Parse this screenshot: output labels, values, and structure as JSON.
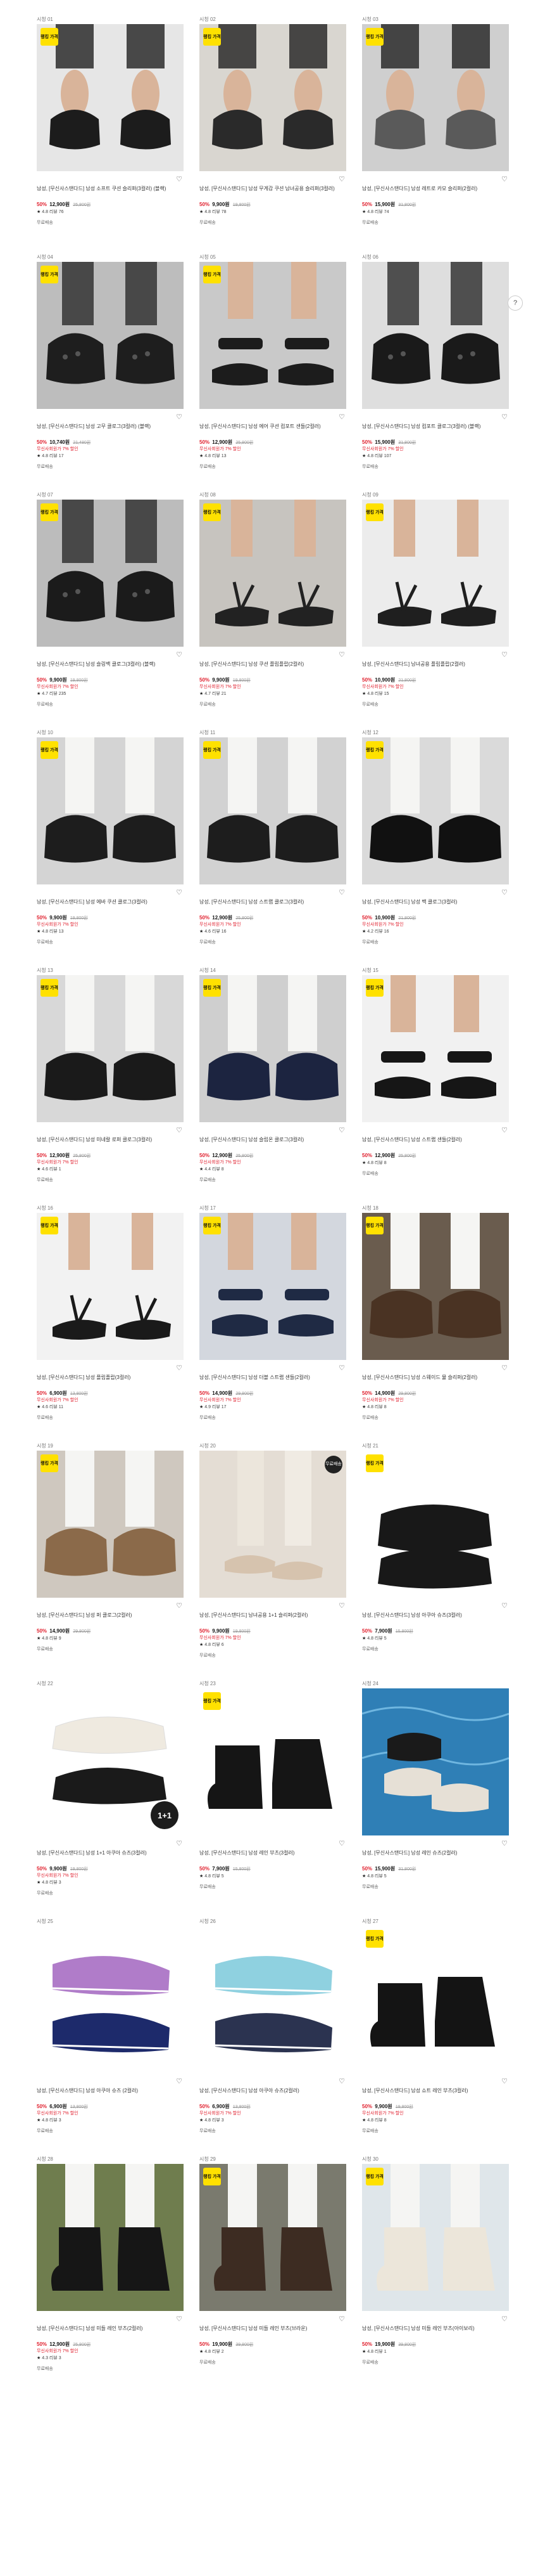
{
  "ui": {
    "badge_text": "랭킹 가격",
    "heart": "♡",
    "star": "★",
    "scroll_up": "?",
    "label_plus": "1+1",
    "label_free": "무료배송"
  },
  "products": [
    {
      "num": "시청 01",
      "badge": true,
      "title": "남성, [무신사스탠다드] 남성 소프트 쿠션 슬리퍼(3컬러) (블랙)",
      "pct": "50%",
      "price": "12,900원",
      "orig": "25,800원",
      "promo": "",
      "rating": "4.8",
      "reviews": "리뷰 76",
      "tag": "무료배송",
      "art": "slide",
      "bg": "#e6e6e6",
      "sc": "#1c1c1c"
    },
    {
      "num": "시청 02",
      "badge": true,
      "title": "남성, [무신사스탠다드] 남성 무게감 쿠션 남녀공용 슬리퍼(3컬러)",
      "pct": "50%",
      "price": "9,900원",
      "orig": "19,800원",
      "promo": "",
      "rating": "4.8",
      "reviews": "리뷰 78",
      "tag": "무료배송",
      "art": "slide",
      "bg": "#d9d6d0",
      "sc": "#2a2a2a"
    },
    {
      "num": "시청 03",
      "badge": true,
      "title": "남성, [무신사스탠다드] 남성 레트로 카모 슬리퍼(2컬러)",
      "pct": "50%",
      "price": "15,900원",
      "orig": "31,800원",
      "promo": "",
      "rating": "4.8",
      "reviews": "리뷰 74",
      "tag": "무료배송",
      "art": "slide",
      "bg": "#cfcfcf",
      "sc": "#5a5a5a"
    },
    {
      "num": "시청 04",
      "badge": true,
      "title": "남성, [무신사스탠다드] 남성 고무 클로그(3컬러) (블랙)",
      "pct": "50%",
      "price": "10,740원",
      "orig": "21,480원",
      "promo": "무신사회원가 7% 할인",
      "rating": "4.8",
      "reviews": "리뷰 17",
      "tag": "무료배송",
      "art": "clog",
      "bg": "#bdbdbd",
      "sc": "#1e1e1e"
    },
    {
      "num": "시청 05",
      "badge": true,
      "title": "남성, [무신사스탠다드] 남성 에어 쿠션 컴포트 샌들(2컬러)",
      "pct": "50%",
      "price": "12,900원",
      "orig": "25,800원",
      "promo": "무신사회원가 7% 할인",
      "rating": "4.8",
      "reviews": "리뷰 13",
      "tag": "무료배송",
      "art": "sandal",
      "bg": "#c9c9c9",
      "sc": "#1c1c1c"
    },
    {
      "num": "시청 06",
      "badge": false,
      "title": "남성, [무신사스탠다드] 남성 컴포트 클로그(3컬러) (블랙)",
      "pct": "50%",
      "price": "15,900원",
      "orig": "31,800원",
      "promo": "무신사회원가 7% 할인",
      "rating": "4.8",
      "reviews": "리뷰 107",
      "tag": "무료배송",
      "art": "clog",
      "bg": "#dedede",
      "sc": "#1a1a1a"
    },
    {
      "num": "시청 07",
      "badge": true,
      "title": "남성, [무신사스탠다드] 남성 슬링백 클로그(3컬러) (블랙)",
      "pct": "50%",
      "price": "9,900원",
      "orig": "19,800원",
      "promo": "무신사회원가 7% 할인",
      "rating": "4.7",
      "reviews": "리뷰 235",
      "tag": "무료배송",
      "art": "clog",
      "bg": "#bcbcbc",
      "sc": "#1b1b1b"
    },
    {
      "num": "시청 08",
      "badge": true,
      "title": "남성, [무신사스탠다드] 남성 쿠션 플립플랍(2컬러)",
      "pct": "50%",
      "price": "9,900원",
      "orig": "19,800원",
      "promo": "무신사회원가 7% 할인",
      "rating": "4.7",
      "reviews": "리뷰 21",
      "tag": "무료배송",
      "art": "flip",
      "bg": "#c7c4bf",
      "sc": "#222222"
    },
    {
      "num": "시청 09",
      "badge": true,
      "title": "남성, [무신사스탠다드] 남녀공용 플립플랍(2컬러)",
      "pct": "50%",
      "price": "10,900원",
      "orig": "21,800원",
      "promo": "무신사회원가 7% 할인",
      "rating": "4.8",
      "reviews": "리뷰 15",
      "tag": "무료배송",
      "art": "flip",
      "bg": "#ececec",
      "sc": "#1f1f1f"
    },
    {
      "num": "시청 10",
      "badge": true,
      "title": "남성, [무신사스탠다드] 남성 에바 쿠션 클로그(3컬러)",
      "pct": "50%",
      "price": "9,900원",
      "orig": "19,800원",
      "promo": "무신사회원가 7% 할인",
      "rating": "4.8",
      "reviews": "리뷰 13",
      "tag": "무료배송",
      "art": "clogsock",
      "bg": "#d4d4d4",
      "sc": "#1d1d1d"
    },
    {
      "num": "시청 11",
      "badge": true,
      "title": "남성, [무신사스탠다드] 남성 스트랩 클로그(3컬러)",
      "pct": "50%",
      "price": "12,900원",
      "orig": "25,800원",
      "promo": "무신사회원가 7% 할인",
      "rating": "4.6",
      "reviews": "리뷰 16",
      "tag": "무료배송",
      "art": "clogsock",
      "bg": "#d2d2d2",
      "sc": "#1d1d1d"
    },
    {
      "num": "시청 12",
      "badge": true,
      "title": "남성, [무신사스탠다드] 남성 백 클로그(3컬러)",
      "pct": "50%",
      "price": "10,900원",
      "orig": "21,800원",
      "promo": "무신사회원가 7% 할인",
      "rating": "4.2",
      "reviews": "리뷰 16",
      "tag": "무료배송",
      "art": "clogsock",
      "bg": "#dadada",
      "sc": "#111111"
    },
    {
      "num": "시청 13",
      "badge": true,
      "title": "남성, [무신사스탠다드] 남성 미네랄 로퍼 클로그(3컬러)",
      "pct": "50%",
      "price": "12,900원",
      "orig": "25,800원",
      "promo": "무신사회원가 7% 할인",
      "rating": "4.6",
      "reviews": "리뷰 1",
      "tag": "무료배송",
      "art": "clogsock",
      "bg": "#d8d8d8",
      "sc": "#1a1a1a"
    },
    {
      "num": "시청 14",
      "badge": true,
      "title": "남성, [무신사스탠다드] 남성 슬립온 클로그(3컬러)",
      "pct": "50%",
      "price": "12,900원",
      "orig": "25,800원",
      "promo": "무신사회원가 7% 할인",
      "rating": "4.4",
      "reviews": "리뷰 8",
      "tag": "무료배송",
      "art": "clogsock",
      "bg": "#cfcfcf",
      "sc": "#1c2440"
    },
    {
      "num": "시청 15",
      "badge": true,
      "title": "남성, [무신사스탠다드] 남성 스트랩 샌들(2컬러)",
      "pct": "50%",
      "price": "12,900원",
      "orig": "25,800원",
      "promo": "",
      "rating": "4.8",
      "reviews": "리뷰 8",
      "tag": "무료배송",
      "art": "sandal",
      "bg": "#f1f1f1",
      "sc": "#161616"
    },
    {
      "num": "시청 16",
      "badge": true,
      "title": "남성, [무신사스탠다드] 남성 플립플랍(3컬러)",
      "pct": "50%",
      "price": "6,900원",
      "orig": "13,800원",
      "promo": "무신사회원가 7% 할인",
      "rating": "4.6",
      "reviews": "리뷰 11",
      "tag": "무료배송",
      "art": "flip",
      "bg": "#f2f2f2",
      "sc": "#1a1a1a"
    },
    {
      "num": "시청 17",
      "badge": true,
      "title": "남성, [무신사스탠다드] 남성 더블 스트랩 샌들(2컬러)",
      "pct": "50%",
      "price": "14,900원",
      "orig": "29,800원",
      "promo": "무신사회원가 7% 할인",
      "rating": "4.9",
      "reviews": "리뷰 17",
      "tag": "무료배송",
      "art": "sandal",
      "bg": "#d3d7de",
      "sc": "#1f2a44"
    },
    {
      "num": "시청 18",
      "badge": true,
      "title": "남성, [무신사스탠다드] 남성 스웨이드 뮬 슬리퍼(2컬러)",
      "pct": "50%",
      "price": "14,900원",
      "orig": "29,800원",
      "promo": "무신사회원가 7% 할인",
      "rating": "4.8",
      "reviews": "리뷰 8",
      "tag": "무료배송",
      "art": "clogsock",
      "bg": "#6a5c4e",
      "sc": "#4a3323"
    },
    {
      "num": "시청 19",
      "badge": true,
      "title": "남성, [무신사스탠다드] 남성 퍼 클로그(2컬러)",
      "pct": "50%",
      "price": "14,900원",
      "orig": "29,800원",
      "promo": "",
      "rating": "4.8",
      "reviews": "리뷰 9",
      "tag": "무료배송",
      "art": "clogsock",
      "bg": "#cfc8bf",
      "sc": "#8b6a4a"
    },
    {
      "num": "시청 20",
      "badge": false,
      "title": "남성, [무신사스탠다드] 남녀공용 1+1 슬리퍼(2컬러)",
      "pct": "50%",
      "price": "9,900원",
      "orig": "19,800원",
      "promo": "무신사회원가 7% 할인",
      "rating": "4.8",
      "reviews": "리뷰 6",
      "tag": "무료배송",
      "art": "legs",
      "bg": "#e4ddd4",
      "sc": "#d6c3ae",
      "free": true
    },
    {
      "num": "시청 21",
      "badge": true,
      "title": "남성, [무신사스탠다드] 남성 아쿠아 슈즈(3컬러)",
      "pct": "50%",
      "price": "7,900원",
      "orig": "15,800원",
      "promo": "",
      "rating": "4.8",
      "reviews": "리뷰 5",
      "tag": "무료배송",
      "art": "bowl",
      "bg": "#ffffff",
      "sc": "#181818"
    },
    {
      "num": "시청 22",
      "badge": false,
      "title": "남성, [무신사스탠다드] 남성 1+1 아쿠아 슈즈(3컬러)",
      "pct": "50%",
      "price": "9,900원",
      "orig": "19,800원",
      "promo": "무신사회원가 7% 할인",
      "rating": "4.8",
      "reviews": "리뷰 3",
      "tag": "무료배송",
      "art": "pair",
      "bg": "#ffffff",
      "sc": "#efeae0",
      "plus": true
    },
    {
      "num": "시청 23",
      "badge": true,
      "title": "남성, [무신사스탠다드] 남성 레인 부츠(3컬러)",
      "pct": "50%",
      "price": "7,900원",
      "orig": "15,800원",
      "promo": "",
      "rating": "4.8",
      "reviews": "리뷰 5",
      "tag": "무료배송",
      "art": "boot",
      "bg": "#ffffff",
      "sc": "#151515"
    },
    {
      "num": "시청 24",
      "badge": false,
      "title": "남성, [무신사스탠다드] 남성 레인 슈즈(2컬러)",
      "pct": "50%",
      "price": "15,900원",
      "orig": "31,800원",
      "promo": "",
      "rating": "4.8",
      "reviews": "리뷰 5",
      "tag": "무료배송",
      "art": "pool",
      "bg": "#3f8fc4",
      "sc": "#e6e0d6"
    },
    {
      "num": "시청 25",
      "badge": false,
      "title": "남성, [무신사스탠다드] 남성 아쿠아 슈즈 (2컬러)",
      "pct": "50%",
      "price": "6,900원",
      "orig": "13,800원",
      "promo": "무신사회원가 7% 할인",
      "rating": "4.8",
      "reviews": "리뷰 3",
      "tag": "무료배송",
      "art": "aqua",
      "bg": "#ffffff",
      "sc": "#b07cc9",
      "sc2": "#1d2a6b"
    },
    {
      "num": "시청 26",
      "badge": false,
      "title": "남성, [무신사스탠다드] 남성 아쿠아 슈즈(2컬러)",
      "pct": "50%",
      "price": "6,900원",
      "orig": "13,800원",
      "promo": "무신사회원가 7% 할인",
      "rating": "4.8",
      "reviews": "리뷰 3",
      "tag": "무료배송",
      "art": "aqua",
      "bg": "#ffffff",
      "sc": "#8fd1e0",
      "sc2": "#2b3350"
    },
    {
      "num": "시청 27",
      "badge": true,
      "title": "남성, [무신사스탠다드] 남성 쇼트 레인 부츠(3컬러)",
      "pct": "50%",
      "price": "9,900원",
      "orig": "19,800원",
      "promo": "무신사회원가 7% 할인",
      "rating": "4.8",
      "reviews": "리뷰 8",
      "tag": "무료배송",
      "art": "boot",
      "bg": "#ffffff",
      "sc": "#141414"
    },
    {
      "num": "시청 28",
      "badge": false,
      "title": "남성, [무신사스탠다드] 남성 미들 레인 부츠(2컬러)",
      "pct": "50%",
      "price": "12,900원",
      "orig": "25,800원",
      "promo": "무신사회원가 7% 할인",
      "rating": "4.3",
      "reviews": "리뷰 3",
      "tag": "무료배송",
      "art": "bootsock",
      "bg": "#6f7d4e",
      "sc": "#161616"
    },
    {
      "num": "시청 29",
      "badge": true,
      "title": "남성, [무신사스탠다드] 남성 미들 레인 부츠(브라운)",
      "pct": "50%",
      "price": "19,900원",
      "orig": "39,800원",
      "promo": "",
      "rating": "4.8",
      "reviews": "리뷰 2",
      "tag": "무료배송",
      "art": "bootsock",
      "bg": "#7a7a6e",
      "sc": "#3d2c22"
    },
    {
      "num": "시청 30",
      "badge": true,
      "title": "남성, [무신사스탠다드] 남성 미들 레인 부츠(아이보리)",
      "pct": "50%",
      "price": "19,900원",
      "orig": "39,800원",
      "promo": "",
      "rating": "4.8",
      "reviews": "리뷰 1",
      "tag": "무료배송",
      "art": "bootsock",
      "bg": "#dfe6ea",
      "sc": "#ece6da"
    }
  ]
}
